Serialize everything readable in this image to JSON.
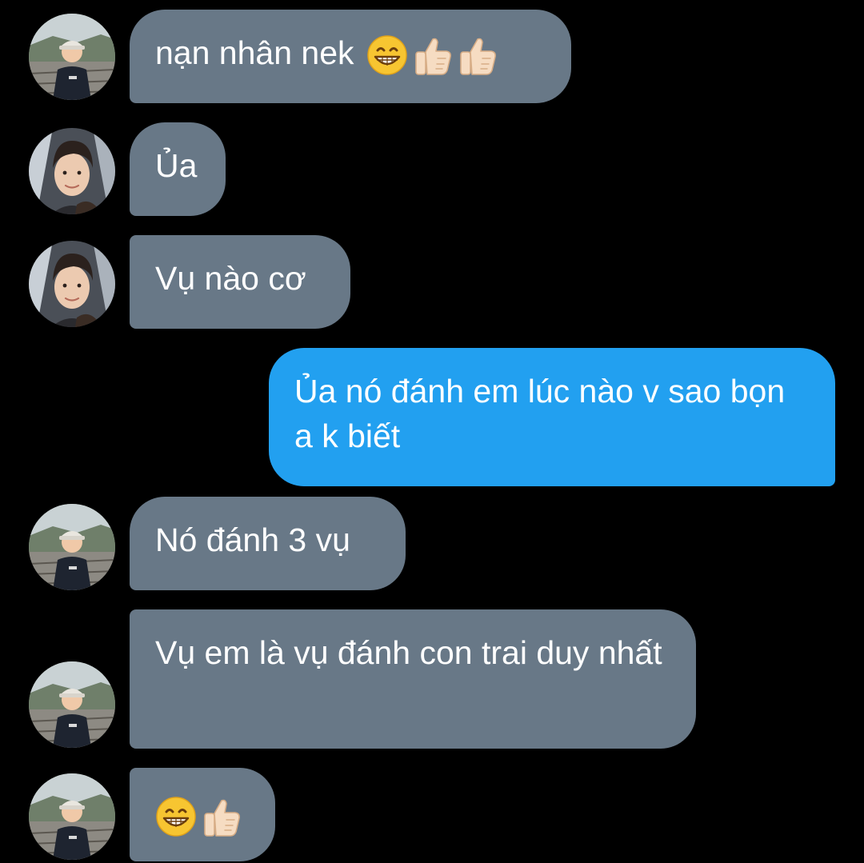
{
  "conversation": {
    "messages": [
      {
        "sender": "boy",
        "direction": "incoming",
        "text": "nạn nhân nek",
        "emojis": [
          "grinning-face-emoji",
          "thumbs-up-emoji",
          "thumbs-up-emoji"
        ]
      },
      {
        "sender": "man",
        "direction": "incoming",
        "text": "Ủa",
        "emojis": []
      },
      {
        "sender": "man",
        "direction": "incoming",
        "text": "Vụ nào cơ",
        "emojis": []
      },
      {
        "sender": "me",
        "direction": "outgoing",
        "text": "Ủa nó đánh em lúc nào v sao bọn a k biết",
        "emojis": []
      },
      {
        "sender": "boy",
        "direction": "incoming",
        "text": "Nó đánh 3 vụ",
        "emojis": []
      },
      {
        "sender": "boy",
        "direction": "incoming",
        "text": "Vụ em là vụ đánh con trai duy nhất",
        "emojis": []
      },
      {
        "sender": "boy",
        "direction": "incoming",
        "text": "",
        "emojis": [
          "grinning-face-emoji",
          "thumbs-up-emoji"
        ]
      }
    ]
  },
  "colors": {
    "background": "#000000",
    "incoming_bubble": "#687887",
    "outgoing_bubble": "#22a0f0",
    "text": "#ffffff"
  }
}
